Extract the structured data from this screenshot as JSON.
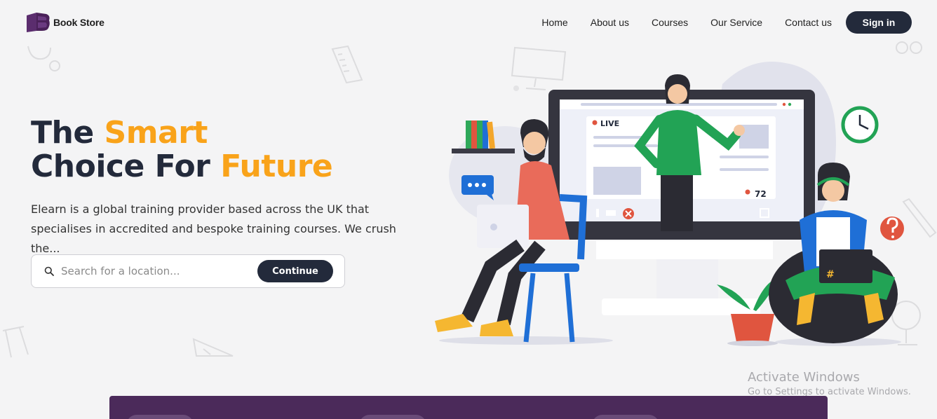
{
  "brand": {
    "name": "Book Store",
    "logo_icon": "book-logo-icon"
  },
  "nav": {
    "links": [
      "Home",
      "About us",
      "Courses",
      "Our Service",
      "Contact us"
    ],
    "signin_label": "Sign in"
  },
  "hero": {
    "title_line1_a": "The ",
    "title_line1_b": "Smart",
    "title_line2_a": "Choice For ",
    "title_line2_b": "Future",
    "description": "Elearn is a global training provider based across the UK that specialises in accredited and bespoke training courses. We crush the...",
    "accent_color": "#f9a31a"
  },
  "search": {
    "placeholder": "Search for a location...",
    "value": "",
    "button_label": "Continue",
    "icon": "search-icon"
  },
  "illustration": {
    "live_label": "LIVE",
    "viewer_count": "72"
  },
  "watermark": {
    "title": "Activate Windows",
    "subtitle": "Go to Settings to activate Windows."
  },
  "colors": {
    "primary_dark": "#232a3b",
    "accent": "#f9a31a",
    "band": "#4b2a5a"
  }
}
